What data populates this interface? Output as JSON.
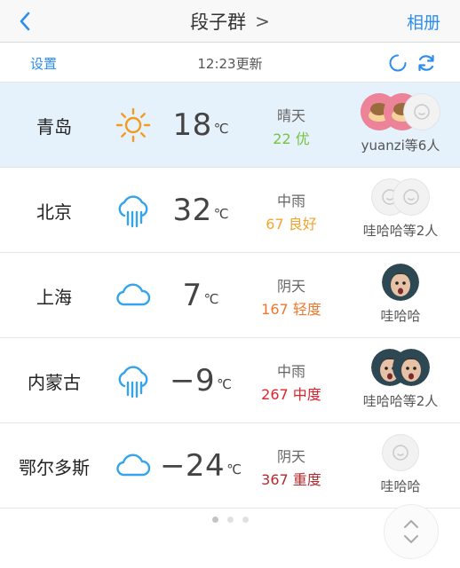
{
  "nav": {
    "title": "段子群",
    "title_chevron": ">",
    "album_label": "相册"
  },
  "subbar": {
    "settings_label": "设置",
    "update_text": "12:23更新"
  },
  "rows": [
    {
      "city": "青岛",
      "weather_icon": "sun-icon",
      "temp": "18",
      "unit": "℃",
      "condition": "晴天",
      "aqi": "22 优",
      "aqi_color": "#79c243",
      "members": "yuanzi等6人",
      "avatars": [
        "avatar-photo-pink",
        "avatar-photo-pink",
        "avatar-placeholder"
      ]
    },
    {
      "city": "北京",
      "weather_icon": "rain-icon",
      "temp": "32",
      "unit": "℃",
      "condition": "中雨",
      "aqi": "67 良好",
      "aqi_color": "#f2a531",
      "members": "哇哈哈等2人",
      "avatars": [
        "avatar-placeholder",
        "avatar-placeholder"
      ]
    },
    {
      "city": "上海",
      "weather_icon": "cloud-icon",
      "temp": "7",
      "unit": "℃",
      "condition": "阴天",
      "aqi": "167 轻度",
      "aqi_color": "#f0772c",
      "members": "哇哈哈",
      "avatars": [
        "avatar-photo-child"
      ]
    },
    {
      "city": "内蒙古",
      "weather_icon": "rain-icon",
      "temp": "−9",
      "unit": "℃",
      "condition": "中雨",
      "aqi": "267 中度",
      "aqi_color": "#e0232b",
      "members": "哇哈哈等2人",
      "avatars": [
        "avatar-photo-child",
        "avatar-photo-child"
      ]
    },
    {
      "city": "鄂尔多斯",
      "weather_icon": "cloud-icon",
      "temp": "−24",
      "unit": "℃",
      "condition": "阴天",
      "aqi": "367 重度",
      "aqi_color": "#b22b2f",
      "members": "哇哈哈",
      "avatars": [
        "avatar-placeholder"
      ]
    }
  ],
  "pager": {
    "pages": 3,
    "current": 1
  },
  "colors": {
    "accent": "#2d8ef0",
    "sun": "#f39a1f",
    "weather_blue": "#36a3ea",
    "active_row": "#e5f1fb"
  }
}
